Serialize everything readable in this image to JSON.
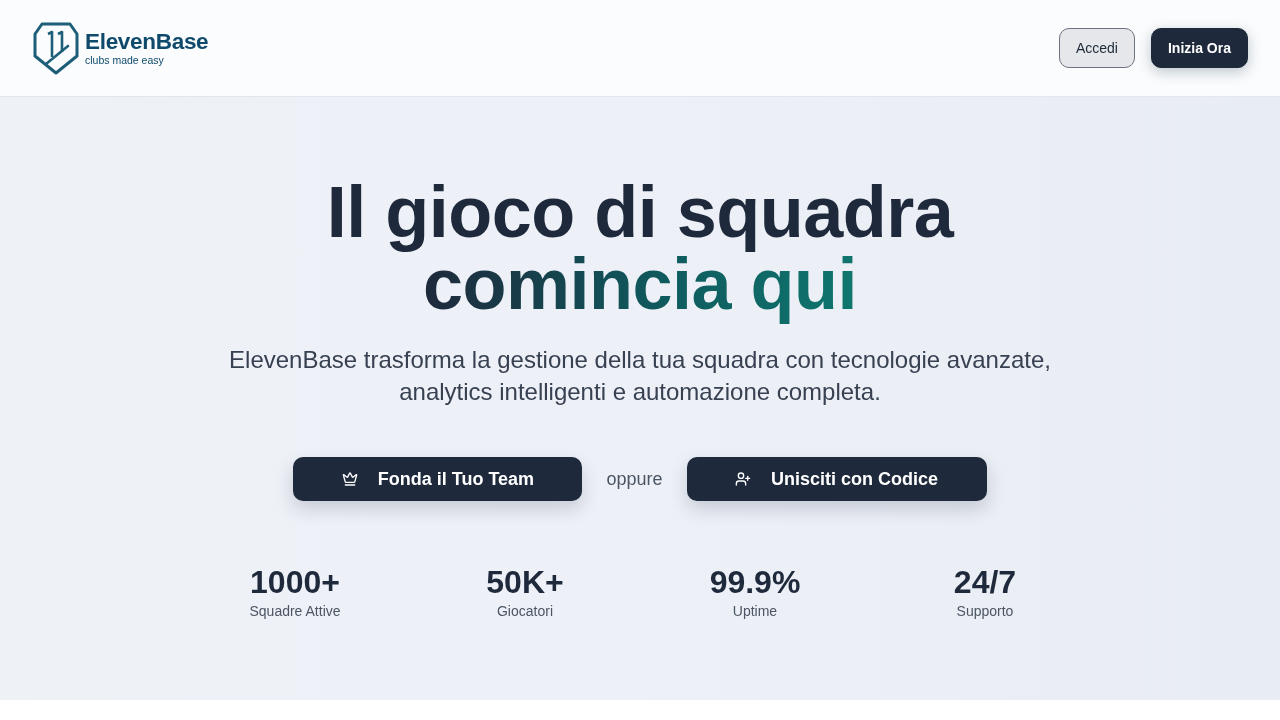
{
  "header": {
    "logo": {
      "name": "ElevenBase",
      "tagline": "clubs made easy"
    },
    "buttons": [
      {
        "label": "Accedi",
        "kind": "outline"
      },
      {
        "label": "Inizia Ora",
        "kind": "primary"
      }
    ]
  },
  "hero": {
    "headline": "Il gioco di squadra",
    "headline_highlight": "comincia qui",
    "subtitle": "ElevenBase trasforma la gestione della tua squadra con tecnologie avanzate, analytics intelligenti e automazione completa.",
    "actions": [
      {
        "label": "Fonda il Tuo Team",
        "kind": "found"
      },
      {
        "label": "Unisciti con Codice",
        "kind": "join"
      }
    ],
    "separator": "oppure",
    "stats": [
      {
        "value": "1000+",
        "label": "Squadre Attive"
      },
      {
        "value": "50K+",
        "label": "Giocatori"
      },
      {
        "value": "99.9%",
        "label": "Uptime"
      },
      {
        "value": "24/7",
        "label": "Supporto"
      }
    ]
  }
}
